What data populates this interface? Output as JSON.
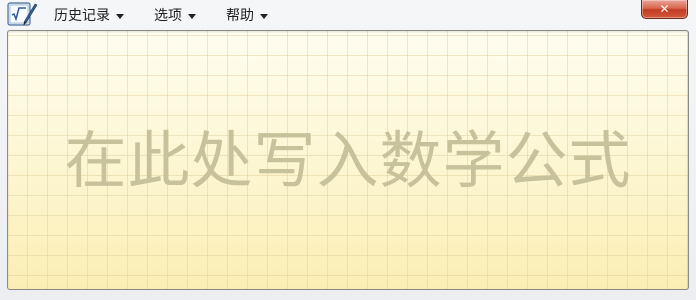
{
  "app": {
    "icon": "math-input-panel-icon"
  },
  "menu": [
    {
      "label": "历史记录",
      "icon": "chevron-down-icon"
    },
    {
      "label": "选项",
      "icon": "chevron-down-icon"
    },
    {
      "label": "帮助",
      "icon": "chevron-down-icon"
    }
  ],
  "window": {
    "close_label": "✕",
    "close_icon": "close-icon"
  },
  "writing_pad": {
    "placeholder": "在此处写入数学公式"
  },
  "colors": {
    "pad_top": "#fffdf0",
    "pad_bottom": "#fbeeb4",
    "grid_line": "#e2d3a0",
    "placeholder_text": "#c7c29c",
    "close_button": "#c23b22"
  }
}
